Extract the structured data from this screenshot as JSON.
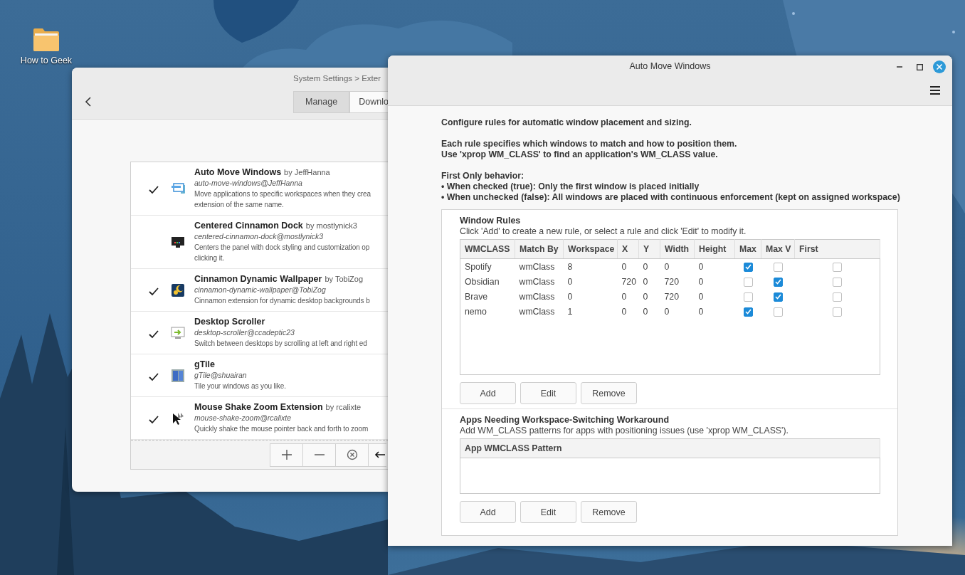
{
  "desktop": {
    "icons": [
      {
        "label": "How to Geek"
      }
    ]
  },
  "settings_window": {
    "breadcrumb": "System Settings > Exter",
    "tabs": [
      {
        "label": "Manage",
        "selected": true
      },
      {
        "label": "Downlo",
        "selected": false
      }
    ],
    "extensions": [
      {
        "kind": "windows",
        "name": "Auto Move Windows",
        "byline": "by JeffHanna",
        "uuid": "auto-move-windows@JeffHanna",
        "description": [
          "Move applications to specific workspaces when they crea",
          "extension of the same name."
        ],
        "enabled": true
      },
      {
        "kind": "dock",
        "name": "Centered Cinnamon Dock",
        "byline": "by mostlynick3",
        "uuid": "centered-cinnamon-dock@mostlynick3",
        "description": [
          "Centers the panel with dock styling and customization op",
          "clicking it."
        ],
        "enabled": false
      },
      {
        "kind": "wallpaper",
        "name": "Cinnamon Dynamic Wallpaper",
        "byline": "by TobiZog",
        "uuid": "cinnamon-dynamic-wallpaper@TobiZog",
        "description": [
          "Cinnamon extension for dynamic desktop backgrounds b"
        ],
        "enabled": true
      },
      {
        "kind": "scroller",
        "name": "Desktop Scroller",
        "uuid": "desktop-scroller@ccadeptic23",
        "description": [
          "Switch between desktops by scrolling at left and right ed"
        ],
        "enabled": true
      },
      {
        "kind": "tile",
        "name": "gTile",
        "uuid": "gTile@shuairan",
        "description": [
          "Tile your windows as you like."
        ],
        "enabled": true
      },
      {
        "kind": "pointer",
        "name": "Mouse Shake Zoom Extension",
        "byline": "by rcalixte",
        "uuid": "mouse-shake-zoom@rcalixte",
        "description": [
          "Quickly shake the mouse pointer back and forth to zoom"
        ],
        "enabled": true
      }
    ]
  },
  "rules_window": {
    "title": "Auto Move Windows",
    "intro": [
      [
        "Configure rules for automatic window placement and sizing."
      ],
      [
        "Each rule specifies which windows to match and how to position them.",
        "Use 'xprop WM_CLASS' to find an application's WM_CLASS value."
      ],
      [
        "First Only behavior:",
        "• When checked (true): Only the first window is placed initially",
        "• When unchecked (false): All windows are placed with continuous enforcement (kept on assigned workspace)"
      ]
    ],
    "sections": [
      {
        "title": "Window Rules",
        "hint": "Click 'Add' to create a new rule, or select a rule and click 'Edit' to modify it.",
        "table": {
          "columns": [
            "WMCLASS",
            "Match By",
            "Workspace",
            "X",
            "Y",
            "Width",
            "Height",
            "Max",
            "Max V",
            "First"
          ],
          "rows": [
            {
              "values": [
                "Spotify",
                "wmClass",
                "8",
                "0",
                "0",
                "0",
                "0",
                true,
                false,
                false
              ]
            },
            {
              "values": [
                "Obsidian",
                "wmClass",
                "0",
                "720",
                "0",
                "720",
                "0",
                false,
                true,
                false
              ]
            },
            {
              "values": [
                "Brave",
                "wmClass",
                "0",
                "0",
                "0",
                "720",
                "0",
                false,
                true,
                false
              ]
            },
            {
              "values": [
                "nemo",
                "wmClass",
                "1",
                "0",
                "0",
                "0",
                "0",
                true,
                false,
                false
              ]
            }
          ]
        },
        "buttons": [
          "Add",
          "Edit",
          "Remove"
        ]
      },
      {
        "title": "Apps Needing Workspace-Switching Workaround",
        "hint": "Add WM_CLASS patterns for apps with positioning issues (use 'xprop WM_CLASS').",
        "table": {
          "columns": [
            "App WMCLASS Pattern"
          ]
        },
        "buttons": [
          "Add",
          "Edit",
          "Remove"
        ]
      }
    ]
  }
}
